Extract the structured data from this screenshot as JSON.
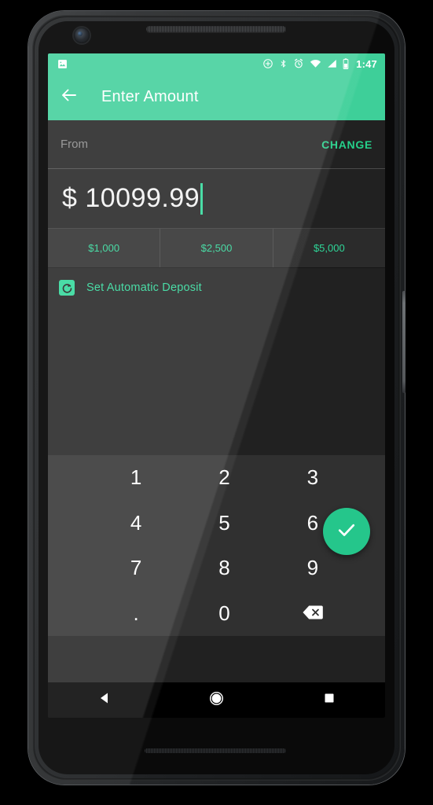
{
  "device": {
    "name": "android-phone",
    "components": [
      "earpiece-speaker",
      "front-camera",
      "bottom-speaker",
      "power-button"
    ]
  },
  "status_bar": {
    "background": "#3ecf99",
    "clock": "1:47",
    "left_icons": [
      "image-notification-icon"
    ],
    "right_icons": [
      "location-icon",
      "bluetooth-icon",
      "alarm-icon",
      "wifi-icon",
      "cellular-signal-icon",
      "battery-icon"
    ]
  },
  "app_bar": {
    "background": "#3ecf99",
    "back_icon": "arrow-back-icon",
    "title": "Enter Amount"
  },
  "form": {
    "from_label": "From",
    "change_label": "CHANGE",
    "amount_value": "$ 10099.99",
    "amount_caret_color": "#2ed698"
  },
  "quick_amounts": [
    {
      "label": "$1,000"
    },
    {
      "label": "$2,500"
    },
    {
      "label": "$5,000"
    }
  ],
  "auto_deposit": {
    "icon": "autorenew-icon",
    "label": "Set Automatic Deposit",
    "color": "#2ed698"
  },
  "fab": {
    "icon": "check-icon",
    "color": "#25c68b"
  },
  "keypad": {
    "keys": [
      {
        "label": "1",
        "name": "key-1"
      },
      {
        "label": "2",
        "name": "key-2"
      },
      {
        "label": "3",
        "name": "key-3"
      },
      {
        "label": "4",
        "name": "key-4"
      },
      {
        "label": "5",
        "name": "key-5"
      },
      {
        "label": "6",
        "name": "key-6"
      },
      {
        "label": "7",
        "name": "key-7"
      },
      {
        "label": "8",
        "name": "key-8"
      },
      {
        "label": "9",
        "name": "key-9"
      },
      {
        "label": ".",
        "name": "key-decimal"
      },
      {
        "label": "0",
        "name": "key-0"
      },
      {
        "label": "",
        "name": "key-backspace",
        "icon": "backspace-icon"
      }
    ]
  },
  "nav_bar": {
    "background": "#000000",
    "buttons": [
      {
        "name": "nav-back-button",
        "icon": "triangle-back-icon"
      },
      {
        "name": "nav-home-button",
        "icon": "circle-home-icon"
      },
      {
        "name": "nav-recents-button",
        "icon": "square-recents-icon"
      }
    ]
  }
}
